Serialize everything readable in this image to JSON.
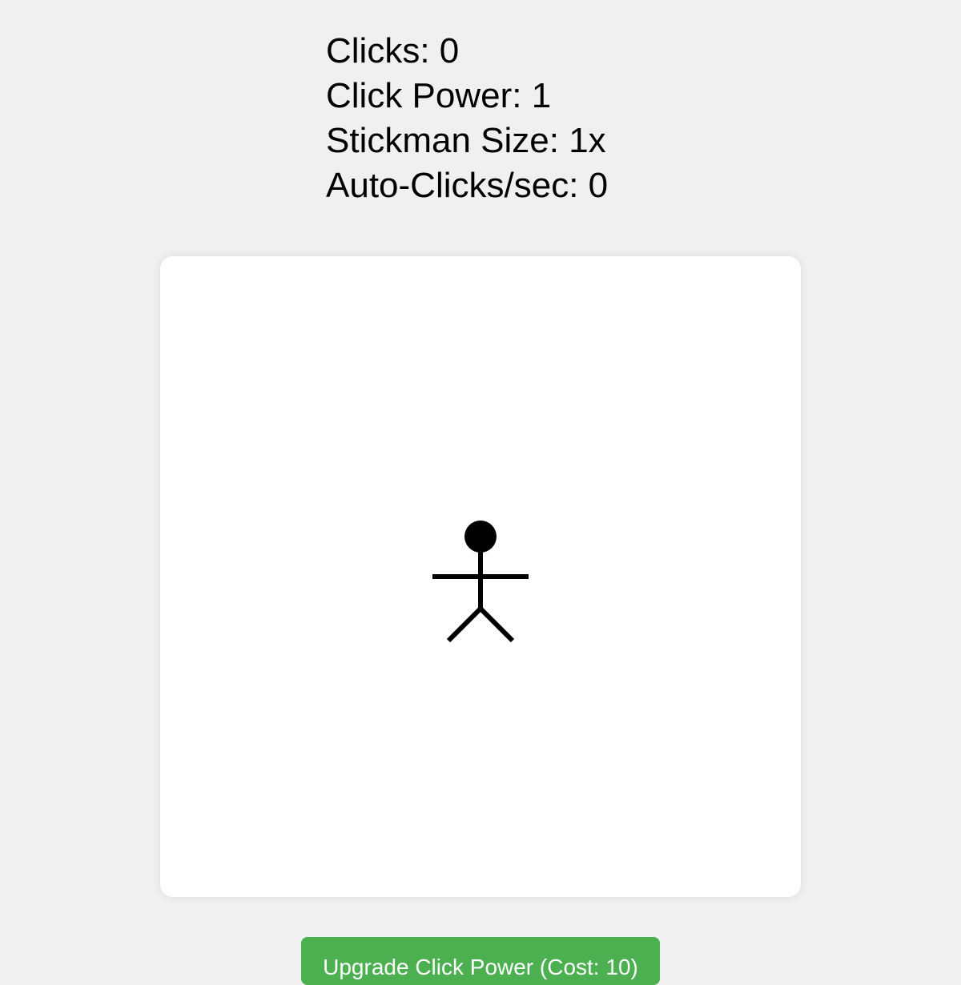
{
  "stats": {
    "clicks": "Clicks: 0",
    "click_power": "Click Power: 1",
    "stickman_size": "Stickman Size: 1x",
    "auto_clicks": "Auto-Clicks/sec: 0"
  },
  "game_area": {
    "stickman_icon": "stickman-icon"
  },
  "upgrades": {
    "click_power_label": "Upgrade Click Power (Cost: 10)"
  },
  "colors": {
    "background": "#f0f0f0",
    "panel": "#ffffff",
    "button": "#4caf50",
    "button_text": "#ffffff",
    "stickman": "#000000"
  }
}
